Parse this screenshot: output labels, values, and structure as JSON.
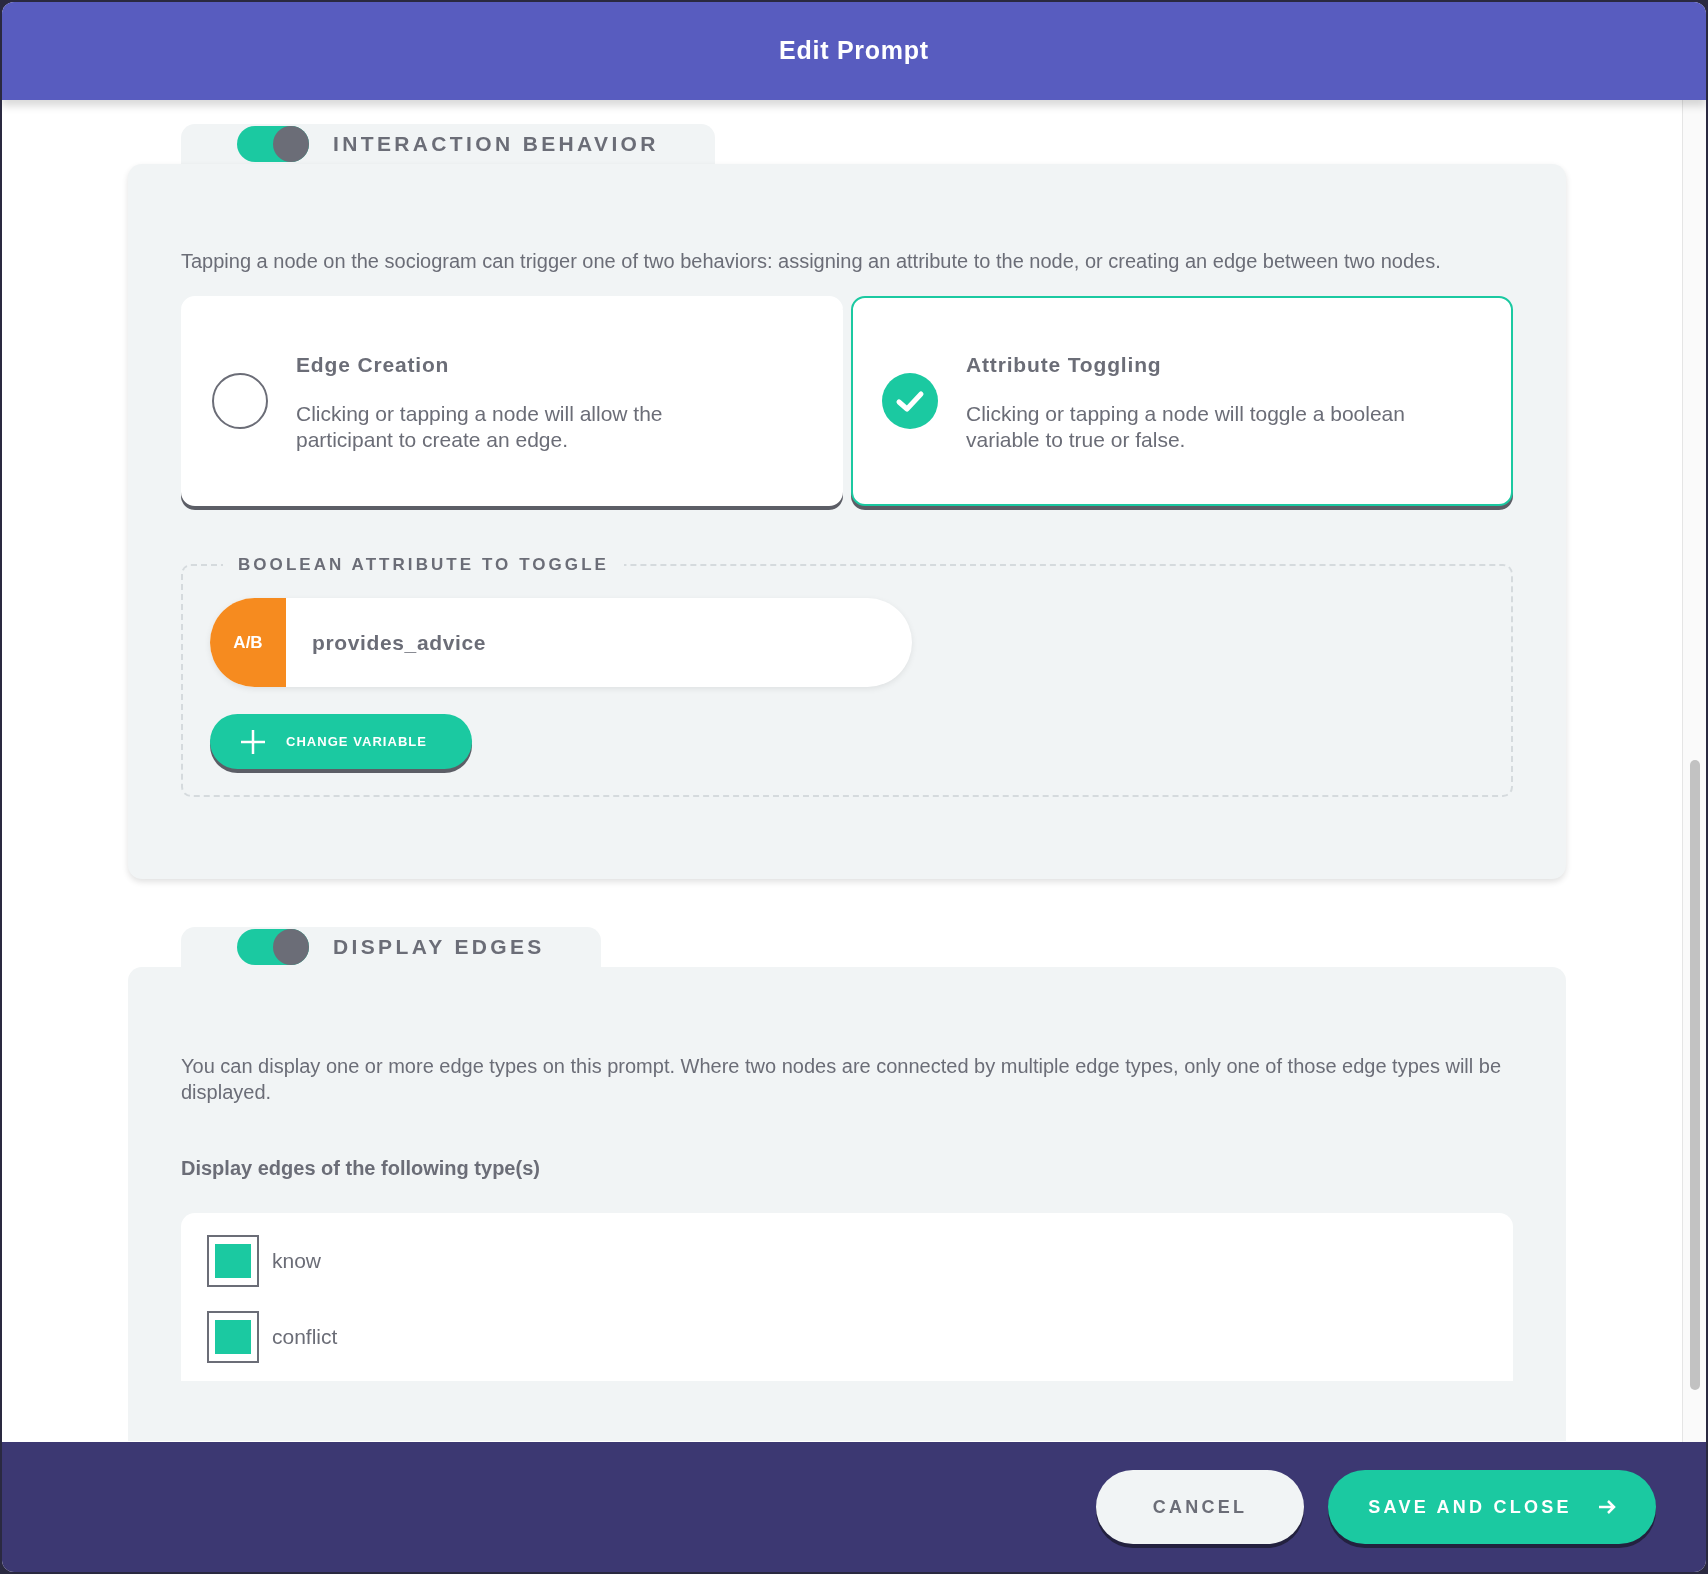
{
  "window": {
    "title": "Edit Prompt"
  },
  "sections": [
    {
      "kind": "interaction",
      "title": "INTERACTION BEHAVIOR",
      "on": true,
      "description": "Tapping a node on the sociogram can trigger one of two behaviors: assigning an attribute to the node, or creating an edge between two nodes.",
      "options": [
        {
          "title": "Edge Creation",
          "description": "Clicking or tapping a node will allow the participant to create an edge.",
          "selected": false
        },
        {
          "title": "Attribute Toggling",
          "description": "Clicking or tapping a node will toggle a boolean variable to true or false.",
          "selected": true
        }
      ],
      "attribute": {
        "legend": "BOOLEAN ATTRIBUTE TO TOGGLE",
        "type_icon": "A/B",
        "variable": "provides_advice",
        "button": "CHANGE VARIABLE"
      }
    },
    {
      "kind": "edges",
      "title": "DISPLAY EDGES",
      "on": true,
      "description": "You can display one or more edge types on this prompt. Where two nodes are connected by multiple edge types, only one of those edge types will be displayed.",
      "label": "Display edges of the following type(s)",
      "edge_types": [
        {
          "label": "know",
          "checked": true
        },
        {
          "label": "conflict",
          "checked": true
        }
      ]
    }
  ],
  "footer": {
    "cancel": "CANCEL",
    "save": "SAVE AND CLOSE"
  }
}
